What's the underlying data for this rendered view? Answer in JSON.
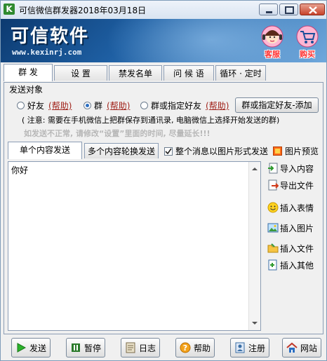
{
  "window": {
    "title": "可信微信群发器2018年03月18日",
    "app_icon_letter": "K"
  },
  "banner": {
    "brand": "可信软件",
    "url": "www.kexinrj.com",
    "kefu_label": "客服",
    "buy_label": "购买"
  },
  "tabs": [
    {
      "label": "群 发",
      "active": true
    },
    {
      "label": "设 置"
    },
    {
      "label": "禁发名单"
    },
    {
      "label": "问 候 语"
    },
    {
      "label": "循环 · 定时"
    }
  ],
  "send_target": {
    "label": "发送对象",
    "options": [
      {
        "label": "好友",
        "selected": false,
        "help": "(帮助)"
      },
      {
        "label": "群",
        "selected": true,
        "help": "(帮助)"
      },
      {
        "label": "群或指定好友",
        "selected": false,
        "help": "(帮助)"
      }
    ],
    "add_button": "群或指定好友-添加",
    "note": "( 注意: 需要在手机微信上把群保存到通讯录, 电脑微信上选择开始发送的群)",
    "warning": "如发送不正常, 请修改“设置”里面的时间, 尽量延长!!!"
  },
  "content_tabs": [
    {
      "label": "单个内容发送",
      "active": true
    },
    {
      "label": "多个内容轮换发送"
    }
  ],
  "image_mode": {
    "label": "整个消息以图片形式发送",
    "checked": true
  },
  "preview_label": "图片预览",
  "editor": {
    "text": "你好"
  },
  "side_actions": [
    {
      "label": "导入内容",
      "icon": "import-icon"
    },
    {
      "label": "导出文件",
      "icon": "export-icon"
    },
    {
      "label": "插入表情",
      "icon": "smiley-icon"
    },
    {
      "label": "插入图片",
      "icon": "picture-icon"
    },
    {
      "label": "插入文件",
      "icon": "folder-icon"
    },
    {
      "label": "插入其他",
      "icon": "insert-other-icon"
    }
  ],
  "bottom_buttons": [
    {
      "label": "发送",
      "icon": "play-icon"
    },
    {
      "label": "暂停",
      "icon": "pause-icon"
    },
    {
      "label": "日志",
      "icon": "log-icon"
    },
    {
      "label": "帮助",
      "icon": "help-icon"
    },
    {
      "label": "注册",
      "icon": "register-icon"
    },
    {
      "label": "网站",
      "icon": "home-icon"
    }
  ],
  "colors": {
    "banner": "#1e5fa3",
    "help_link": "#a0221a",
    "warning": "#b7b7b7"
  }
}
